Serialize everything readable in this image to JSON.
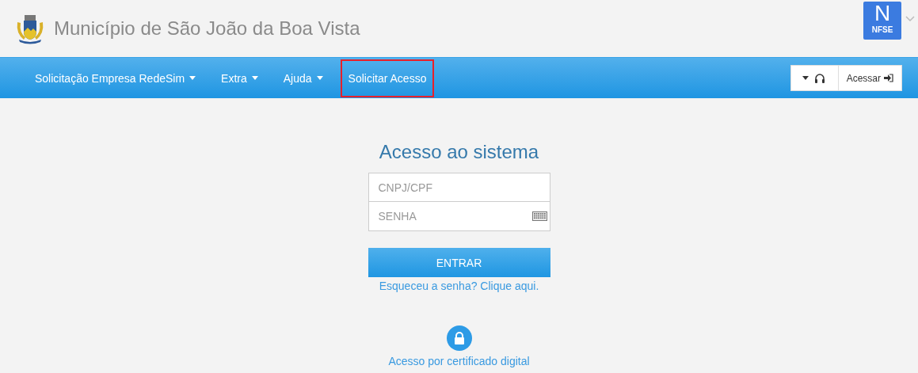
{
  "header": {
    "title": "Município de São João da Boa Vista",
    "badge": {
      "letter": "N",
      "label": "NFSE"
    }
  },
  "navbar": {
    "items": [
      {
        "label": "Solicitação Empresa RedeSim",
        "has_menu": true,
        "highlighted": false
      },
      {
        "label": "Extra",
        "has_menu": true,
        "highlighted": false
      },
      {
        "label": "Ajuda",
        "has_menu": true,
        "highlighted": false
      },
      {
        "label": "Solicitar Acesso",
        "has_menu": false,
        "highlighted": true
      }
    ],
    "login_button": "Acessar"
  },
  "login": {
    "title": "Acesso ao sistema",
    "fields": [
      {
        "placeholder": "CNPJ/CPF",
        "kind": "text"
      },
      {
        "placeholder": "SENHA",
        "kind": "password"
      }
    ],
    "submit": "ENTRAR",
    "forgot_link": "Esqueceu a senha? Clique aqui.",
    "certificate_link": "Acesso por certificado digital"
  }
}
